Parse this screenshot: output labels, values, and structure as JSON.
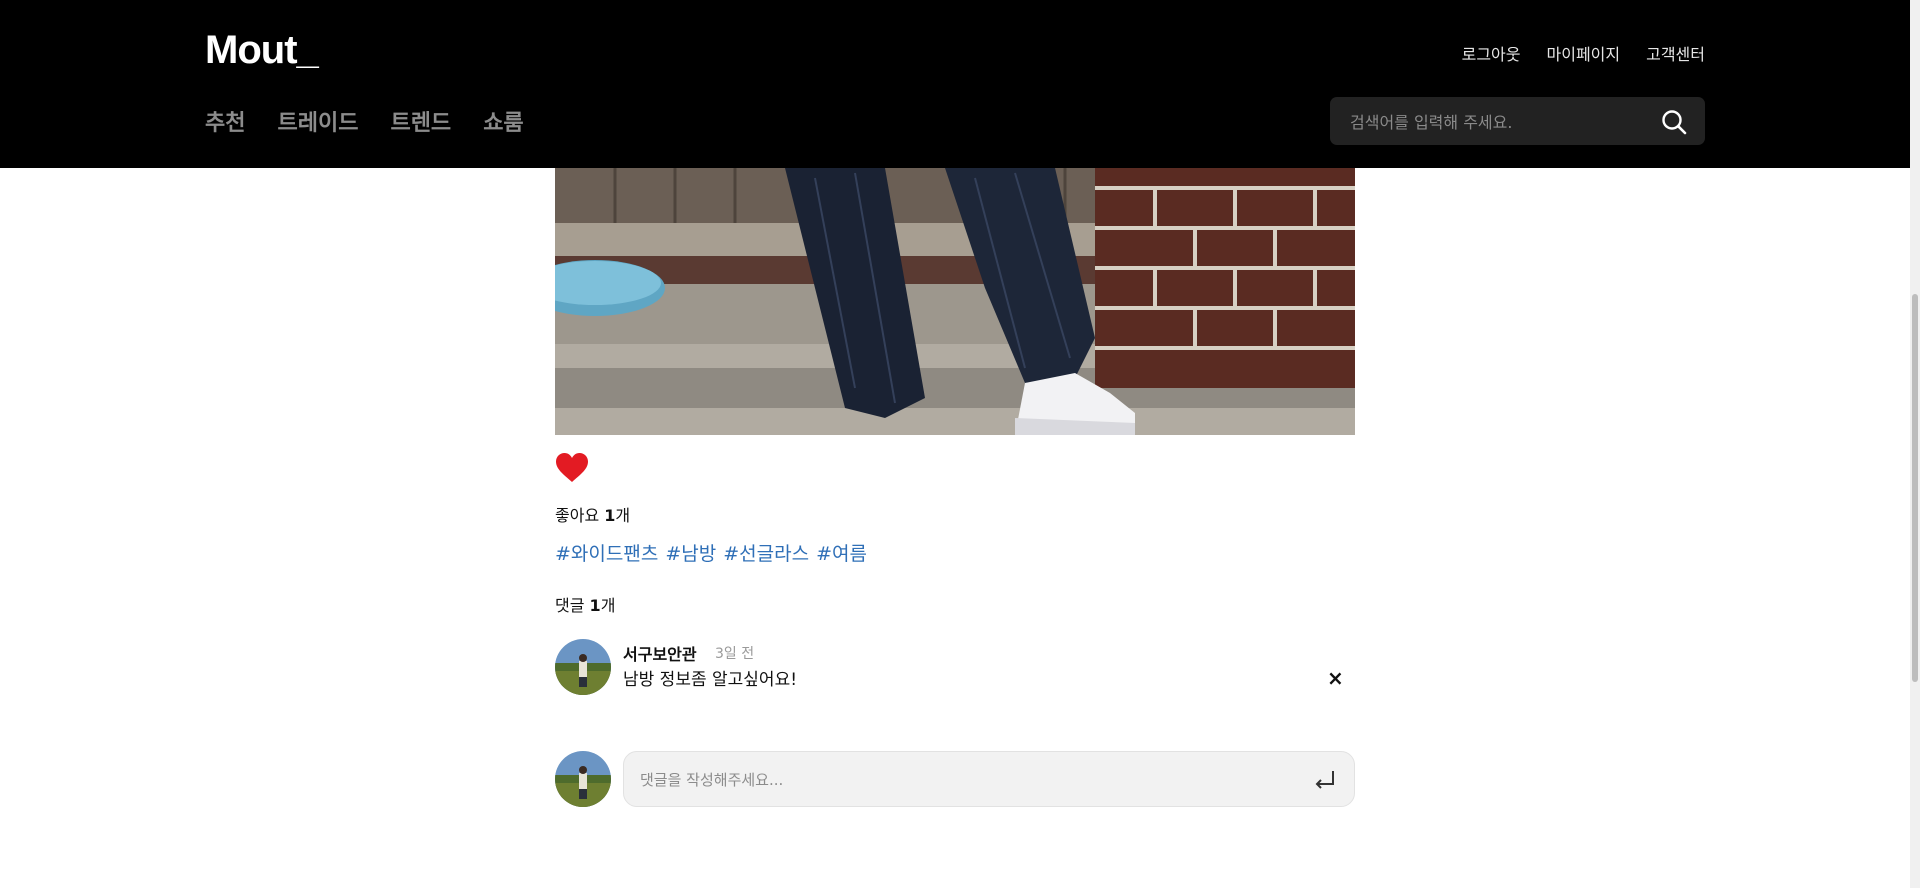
{
  "header": {
    "logo": "Mout_",
    "top_links": [
      "로그아웃",
      "마이페이지",
      "고객센터"
    ],
    "nav": [
      "추천",
      "트레이드",
      "트렌드",
      "쇼룸"
    ],
    "search_placeholder": "검색어를 입력해 주세요."
  },
  "post": {
    "liked": true,
    "likes_label": "좋아요",
    "likes_count": "1",
    "likes_unit": "개",
    "tags": [
      "#와이드팬츠",
      "#남방",
      "#선글라스",
      "#여름"
    ],
    "comments_label": "댓글",
    "comments_count": "1",
    "comments_unit": "개"
  },
  "comments": [
    {
      "author": "서구보안관",
      "time": "3일 전",
      "text": "남방 정보좀 알고싶어요!",
      "delete_symbol": "×"
    }
  ],
  "comment_input": {
    "placeholder": "댓글을 작성해주세요..."
  },
  "colors": {
    "header_bg": "#000000",
    "like_heart": "#e31b23",
    "tag_link": "#2f6fb7"
  }
}
